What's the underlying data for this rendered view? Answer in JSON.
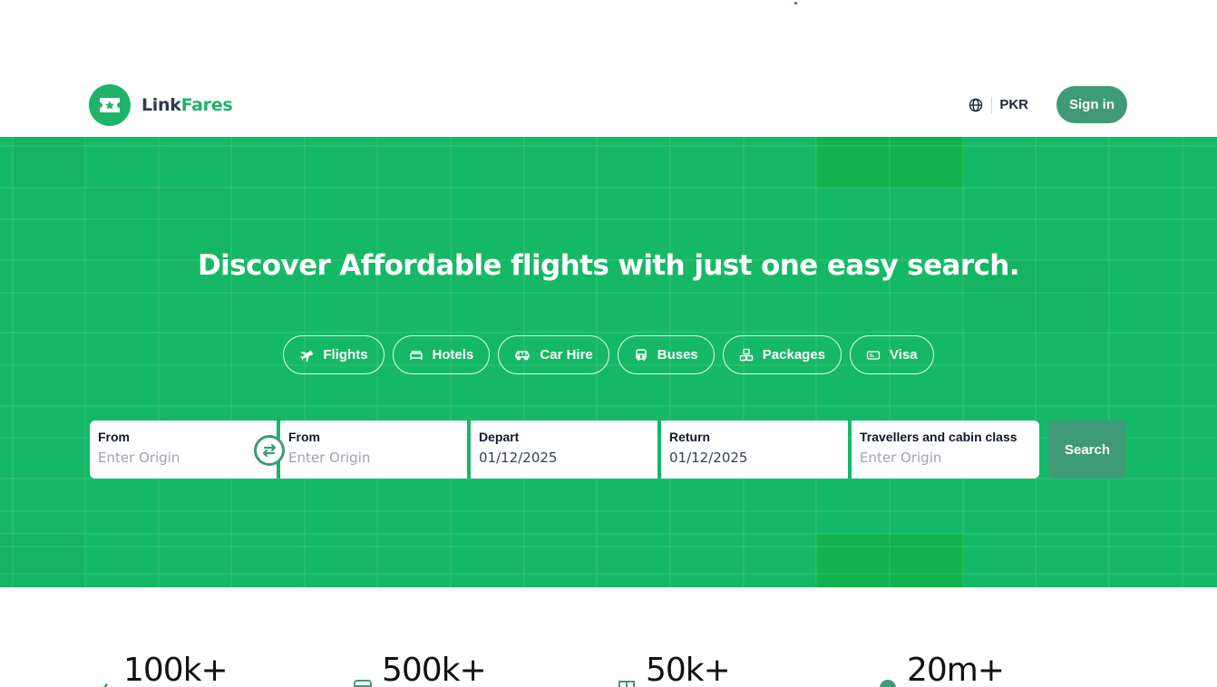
{
  "header": {
    "brand_part1": "Link",
    "brand_part2": "Fares",
    "currency": "PKR",
    "signin_label": "Sign in"
  },
  "hero": {
    "title": "Discover Affordable flights with just one easy search.",
    "tabs": [
      {
        "label": "Flights",
        "icon": "plane-icon"
      },
      {
        "label": "Hotels",
        "icon": "bed-icon"
      },
      {
        "label": "Car Hire",
        "icon": "car-icon"
      },
      {
        "label": "Buses",
        "icon": "bus-icon"
      },
      {
        "label": "Packages",
        "icon": "packages-icon"
      },
      {
        "label": "Visa",
        "icon": "visa-icon"
      }
    ]
  },
  "search": {
    "fields": [
      {
        "label": "From",
        "placeholder": "Enter Origin",
        "value": ""
      },
      {
        "label": "From",
        "placeholder": "Enter Origin",
        "value": ""
      },
      {
        "label": "Depart",
        "placeholder": "",
        "value": "01/12/2025"
      },
      {
        "label": "Return",
        "placeholder": "",
        "value": "01/12/2025"
      },
      {
        "label": "Travellers and cabin class",
        "placeholder": "Enter Origin",
        "value": ""
      }
    ],
    "button_label": "Search"
  },
  "stats": [
    {
      "value": "100k+",
      "icon": "plane-icon"
    },
    {
      "value": "500k+",
      "icon": "bus-icon"
    },
    {
      "value": "50k+",
      "icon": "hotel-icon"
    },
    {
      "value": "20m+",
      "icon": "globe-icon"
    }
  ],
  "colors": {
    "brand_green": "#1db46a",
    "hero_bg": "#15b866",
    "button_green": "#3f9a77"
  }
}
